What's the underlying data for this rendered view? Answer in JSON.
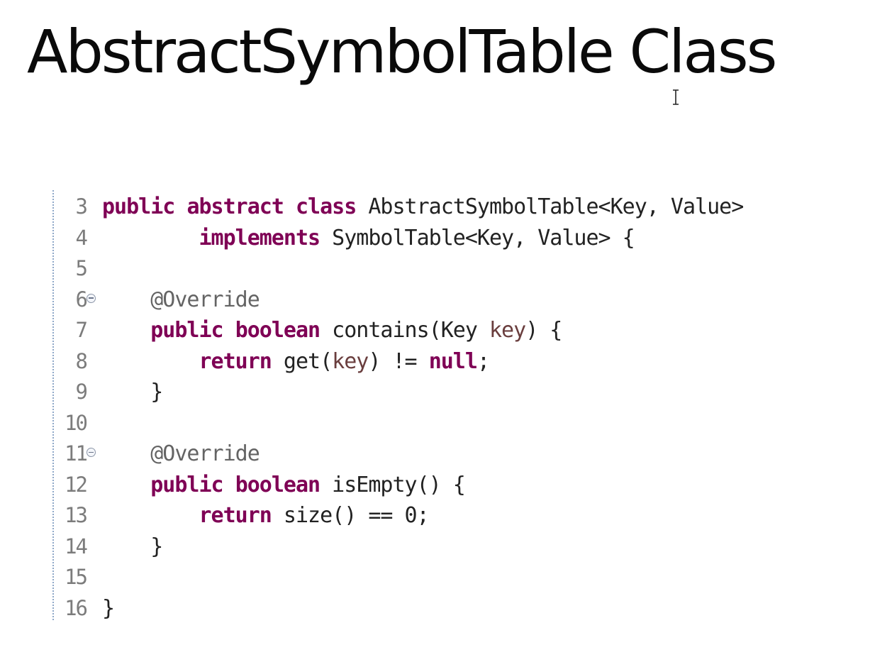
{
  "slide": {
    "title": "AbstractSymbolTable Class"
  },
  "icons": {
    "cursor": "text-cursor-icon",
    "fold": "fold-collapse-icon"
  },
  "colors": {
    "keyword": "#7f0055",
    "annotation": "#646464",
    "parameter": "#6a3e3e",
    "plain_text": "#222222",
    "line_number": "#7c7c7c"
  },
  "code": {
    "lines": [
      {
        "number": "3",
        "foldable": false,
        "tokens": [
          {
            "t": "public",
            "c": "kw"
          },
          {
            "t": " ",
            "c": "plain"
          },
          {
            "t": "abstract",
            "c": "kw"
          },
          {
            "t": " ",
            "c": "plain"
          },
          {
            "t": "class",
            "c": "kw"
          },
          {
            "t": " AbstractSymbolTable<Key, Value>",
            "c": "plain"
          }
        ]
      },
      {
        "number": "4",
        "foldable": false,
        "tokens": [
          {
            "t": "        ",
            "c": "plain"
          },
          {
            "t": "implements",
            "c": "kw"
          },
          {
            "t": " SymbolTable<Key, Value> {",
            "c": "plain"
          }
        ]
      },
      {
        "number": "5",
        "foldable": false,
        "tokens": []
      },
      {
        "number": "6",
        "foldable": true,
        "tokens": [
          {
            "t": "    ",
            "c": "plain"
          },
          {
            "t": "@Override",
            "c": "ann"
          }
        ]
      },
      {
        "number": "7",
        "foldable": false,
        "tokens": [
          {
            "t": "    ",
            "c": "plain"
          },
          {
            "t": "public",
            "c": "kw"
          },
          {
            "t": " ",
            "c": "plain"
          },
          {
            "t": "boolean",
            "c": "kw"
          },
          {
            "t": " contains(Key ",
            "c": "plain"
          },
          {
            "t": "key",
            "c": "param"
          },
          {
            "t": ") {",
            "c": "plain"
          }
        ]
      },
      {
        "number": "8",
        "foldable": false,
        "tokens": [
          {
            "t": "        ",
            "c": "plain"
          },
          {
            "t": "return",
            "c": "kw"
          },
          {
            "t": " get(",
            "c": "plain"
          },
          {
            "t": "key",
            "c": "param"
          },
          {
            "t": ") != ",
            "c": "plain"
          },
          {
            "t": "null",
            "c": "kw"
          },
          {
            "t": ";",
            "c": "plain"
          }
        ]
      },
      {
        "number": "9",
        "foldable": false,
        "tokens": [
          {
            "t": "    }",
            "c": "plain"
          }
        ]
      },
      {
        "number": "10",
        "foldable": false,
        "tokens": []
      },
      {
        "number": "11",
        "foldable": true,
        "tokens": [
          {
            "t": "    ",
            "c": "plain"
          },
          {
            "t": "@Override",
            "c": "ann"
          }
        ]
      },
      {
        "number": "12",
        "foldable": false,
        "tokens": [
          {
            "t": "    ",
            "c": "plain"
          },
          {
            "t": "public",
            "c": "kw"
          },
          {
            "t": " ",
            "c": "plain"
          },
          {
            "t": "boolean",
            "c": "kw"
          },
          {
            "t": " isEmpty() {",
            "c": "plain"
          }
        ]
      },
      {
        "number": "13",
        "foldable": false,
        "tokens": [
          {
            "t": "        ",
            "c": "plain"
          },
          {
            "t": "return",
            "c": "kw"
          },
          {
            "t": " size() == 0;",
            "c": "plain"
          }
        ]
      },
      {
        "number": "14",
        "foldable": false,
        "tokens": [
          {
            "t": "    }",
            "c": "plain"
          }
        ]
      },
      {
        "number": "15",
        "foldable": false,
        "tokens": []
      },
      {
        "number": "16",
        "foldable": false,
        "tokens": [
          {
            "t": "}",
            "c": "plain"
          }
        ]
      }
    ]
  }
}
